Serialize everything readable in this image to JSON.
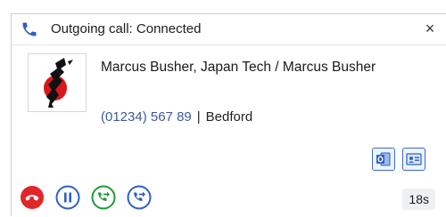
{
  "window": {
    "title": "Outgoing call: Connected",
    "close_label": "×"
  },
  "contact": {
    "name": "Marcus Busher, Japan Tech / Marcus Busher",
    "phone": "(01234) 567 89",
    "separator": "|",
    "city": "Bedford"
  },
  "timer": "18s",
  "colors": {
    "accent_blue": "#2f5fc4",
    "hangup_red": "#e0262a",
    "transfer_green": "#1f9a3a",
    "phone_link": "#3d5a98"
  },
  "icons": {
    "title": "phone-icon",
    "close": "close-icon",
    "outlook": "outlook-icon",
    "contact_card": "contact-card-icon",
    "hangup": "hangup-icon",
    "hold": "pause-icon",
    "transfer": "transfer-icon",
    "forward": "forward-icon"
  }
}
